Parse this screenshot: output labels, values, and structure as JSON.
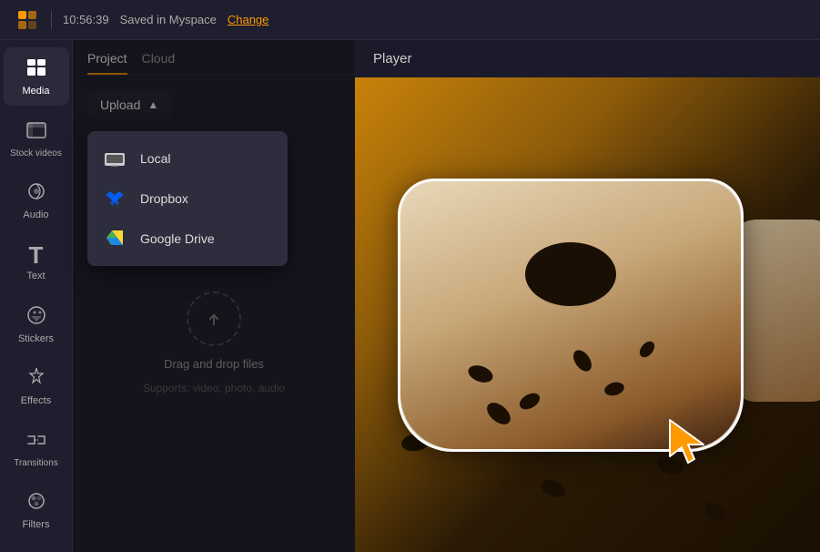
{
  "topbar": {
    "time": "10:56:39",
    "saved_text": "Saved in Myspace",
    "change_label": "Change"
  },
  "sidebar": {
    "items": [
      {
        "id": "media",
        "label": "Media",
        "icon": "▦",
        "active": true
      },
      {
        "id": "stock-videos",
        "label": "Stock videos",
        "icon": "⊞"
      },
      {
        "id": "audio",
        "label": "Audio",
        "icon": "◎"
      },
      {
        "id": "text",
        "label": "Text",
        "icon": "T"
      },
      {
        "id": "stickers",
        "label": "Stickers",
        "icon": "✦"
      },
      {
        "id": "effects",
        "label": "Effects",
        "icon": "✧"
      },
      {
        "id": "transitions",
        "label": "Transitions",
        "icon": "⇌"
      },
      {
        "id": "filters",
        "label": "Filters",
        "icon": "❋"
      }
    ]
  },
  "panel": {
    "tabs": [
      {
        "id": "project",
        "label": "Project",
        "active": true
      },
      {
        "id": "cloud",
        "label": "Cloud",
        "active": false
      }
    ],
    "upload_button": "Upload",
    "dropdown_items": [
      {
        "id": "local",
        "label": "Local",
        "icon": "🖥"
      },
      {
        "id": "dropbox",
        "label": "Dropbox",
        "icon": "📦"
      },
      {
        "id": "google-drive",
        "label": "Google Drive",
        "icon": "▲"
      }
    ],
    "drop_zone": {
      "main_text": "Drag and drop files",
      "sub_text": "Supports: video, photo, audio"
    }
  },
  "player": {
    "title": "Player"
  },
  "colors": {
    "accent": "#ff9900",
    "active_tab_border": "#ff9900",
    "bg_dark": "#1e1e2e",
    "bg_panel": "#252535",
    "dropdown_bg": "#2d2d3d"
  }
}
